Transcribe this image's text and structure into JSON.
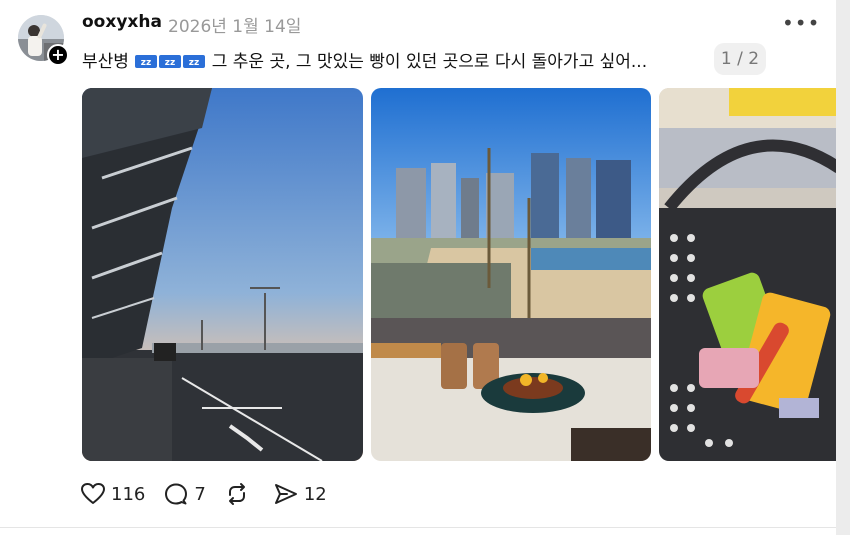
{
  "post": {
    "username": "ooxyxha",
    "date": "2026년 1월 14일",
    "caption_prefix": "부산병",
    "caption_text": "그 추운 곳, 그 맛있는 빵이 있던 곳으로 다시 돌아가고 싶어...",
    "pager": "1 / 2"
  },
  "icons": {
    "follow": "plus-icon",
    "more": "more-horizontal-icon",
    "sleep": "zzz-emoji-icon",
    "like": "heart-icon",
    "reply": "comment-icon",
    "repost": "repost-icon",
    "share": "send-icon"
  },
  "actions": {
    "likes": "116",
    "replies": "7",
    "shares": "12"
  },
  "colors": {
    "date_gray": "#999999",
    "zzz_blue": "#2b6fd8",
    "pager_bg": "#f0f0f0"
  }
}
